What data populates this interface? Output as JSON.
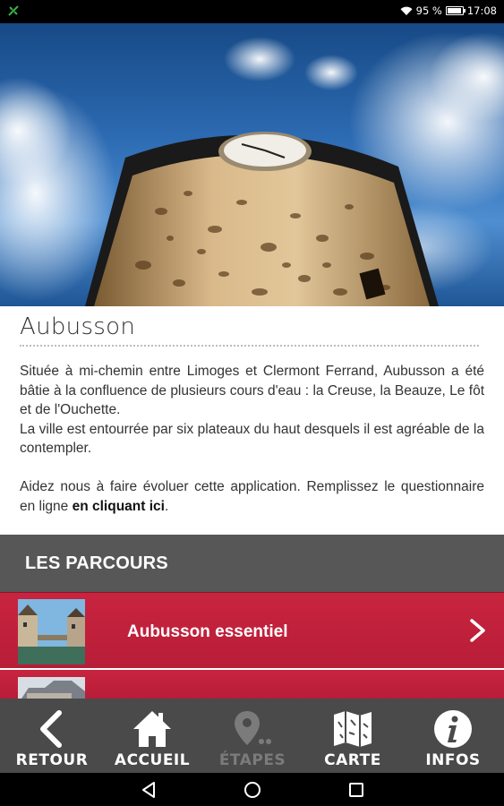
{
  "status_bar": {
    "left_icon": "notification-app-icon",
    "wifi_icon": "wifi-icon",
    "battery_percent": "95 %",
    "battery_level": 0.95,
    "time": "17:08"
  },
  "hero": {
    "image": "clock-tower-photo"
  },
  "city": {
    "title": "Aubusson",
    "paragraph1": "Située à mi-chemin entre Limoges et Clermont Ferrand, Aubusson a été bâtie à la confluence de plusieurs cours d'eau : la Creuse, la Beauze, Le fôt et de l'Ouchette.",
    "paragraph2": "La ville est entourrée par six plateaux du haut desquels il est agréable de la contempler.",
    "paragraph3_prefix": "Aidez nous à faire évoluer cette application. Remplissez le questionnaire en ligne ",
    "paragraph3_link": "en cliquant ici",
    "paragraph3_suffix": "."
  },
  "section": {
    "title": "LES PARCOURS"
  },
  "routes": [
    {
      "label": "Aubusson essentiel",
      "icon": "chevron-right-icon"
    },
    {
      "label": ""
    }
  ],
  "bottom_nav": [
    {
      "label": "RETOUR",
      "icon": "back-arrow-icon",
      "enabled": true
    },
    {
      "label": "ACCUEIL",
      "icon": "home-icon",
      "enabled": true
    },
    {
      "label": "ÉTAPES",
      "icon": "map-pin-icon",
      "enabled": false
    },
    {
      "label": "CARTE",
      "icon": "map-icon",
      "enabled": true
    },
    {
      "label": "INFOS",
      "icon": "info-icon",
      "enabled": true
    }
  ],
  "system_nav": {
    "back": "back-triangle-icon",
    "home": "home-circle-icon",
    "recents": "recents-square-icon"
  },
  "colors": {
    "route_red": "#c8243f",
    "section_gray": "#575757",
    "nav_gray": "#4a4a4a",
    "disabled_text": "#7b7b7b"
  }
}
